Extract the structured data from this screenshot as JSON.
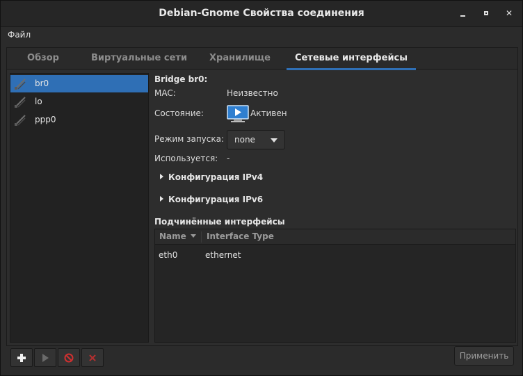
{
  "window": {
    "title": "Debian-Gnome Свойства соединения"
  },
  "menu": {
    "file": "Файл"
  },
  "tabs": [
    {
      "label": "Обзор"
    },
    {
      "label": "Виртуальные сети"
    },
    {
      "label": "Хранилище"
    },
    {
      "label": "Сетевые интерфейсы",
      "active": true
    }
  ],
  "interfaces": [
    {
      "name": "br0",
      "selected": true
    },
    {
      "name": "lo"
    },
    {
      "name": "ppp0"
    }
  ],
  "detail": {
    "heading": "Bridge br0:",
    "mac_label": "MAC:",
    "mac_value": "Неизвестно",
    "state_label": "Состояние:",
    "state_value": "Активен",
    "state_icon": "monitor-play-icon",
    "start_mode_label": "Режим запуска:",
    "start_mode_value": "none",
    "used_by_label": "Используется:",
    "used_by_value": "-",
    "ipv4_label": "Конфигурация IPv4",
    "ipv6_label": "Конфигурация IPv6",
    "slaves_heading": "Подчинённые интерфейсы",
    "table": {
      "headers": [
        "Name",
        "Interface Type"
      ],
      "rows": [
        [
          "eth0",
          "ethernet"
        ]
      ]
    }
  },
  "toolbar": {
    "add_icon": "plus-icon",
    "start_icon": "play-icon",
    "stop_icon": "stop-icon",
    "delete_icon": "delete-x-icon",
    "apply_label": "Применить"
  },
  "colors": {
    "accent": "#2f6fb5",
    "delete": "#b03030"
  }
}
